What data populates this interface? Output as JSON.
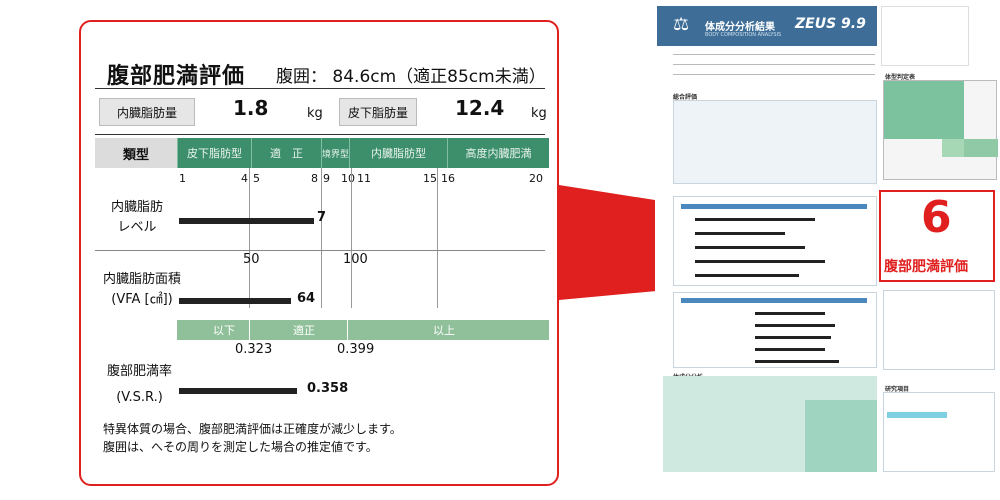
{
  "zoom": {
    "title": "腹部肥満評価",
    "waist_text": "腹囲： 84.6cm（適正85cm未満）",
    "visceral_fat_mass_label": "内臓脂肪量",
    "visceral_fat_mass_value": "1.8",
    "visceral_fat_mass_unit": "kg",
    "subcutaneous_fat_mass_label": "皮下脂肪量",
    "subcutaneous_fat_mass_value": "12.4",
    "subcutaneous_fat_mass_unit": "kg",
    "type_header": "類型",
    "categories": [
      "皮下脂肪型",
      "適　正",
      "境界型",
      "内臓脂肪型",
      "高度内臓肥満"
    ],
    "scale_numbers": [
      "1",
      "4",
      "5",
      "8",
      "9",
      "10",
      "11",
      "15",
      "16",
      "20"
    ],
    "vfl_label_1": "内臓脂肪",
    "vfl_label_2": "レベル",
    "vfl_value": "7",
    "vfl_level": 7,
    "vfa_label_1": "内臓脂肪面積",
    "vfa_label_2": "(VFA [㎠])",
    "vfa_ticks": [
      "50",
      "100"
    ],
    "vfa_value": "64",
    "vsr_band": [
      "以下",
      "適正",
      "以上"
    ],
    "vsr_ticks": [
      "0.323",
      "0.399"
    ],
    "vsr_label_1": "腹部肥満率",
    "vsr_label_2": "(V.S.R.)",
    "vsr_value": "0.358",
    "note_1": "特異体質の場合、腹部肥満評価は正確度が減少します。",
    "note_2": "腹囲は、へその周りを測定した場合の推定値です。"
  },
  "doc": {
    "header_title": "体成分分析結果",
    "header_sub": "BODY COMPOSITION ANALYSIS",
    "logo": "ZEUS 9.9",
    "callout_number": "6",
    "callout_label": "腹部肥満評価",
    "section_body_type": "体型判定表",
    "section_overall": "総合評価",
    "section_composition": "体成分分析",
    "section_research": "研究項目"
  },
  "colors": {
    "accent_red": "#e0201f",
    "header_blue": "#3e6e98",
    "band_green": "#3d8f6c"
  }
}
